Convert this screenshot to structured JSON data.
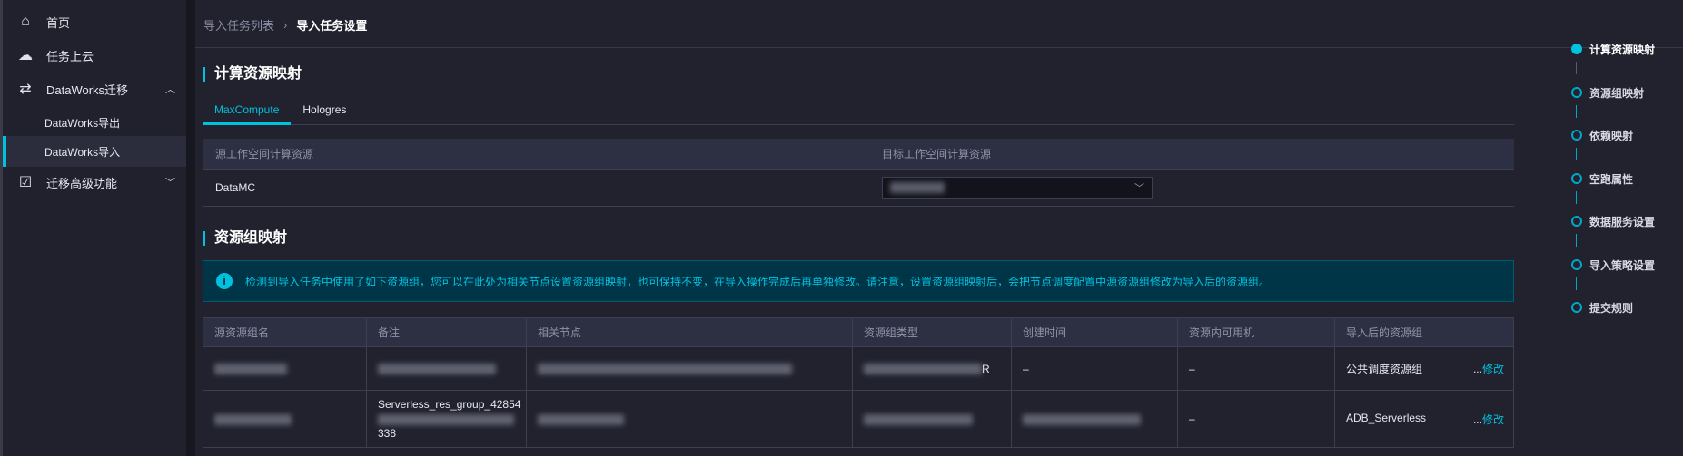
{
  "sidebar": {
    "items": [
      {
        "label": "首页",
        "icon": "home-icon"
      },
      {
        "label": "任务上云",
        "icon": "cloud-upload-icon"
      },
      {
        "label": "DataWorks迁移",
        "icon": "migrate-icon",
        "expanded": true,
        "children": [
          {
            "label": "DataWorks导出"
          },
          {
            "label": "DataWorks导入",
            "active": true
          }
        ]
      },
      {
        "label": "迁移高级功能",
        "icon": "calendar-check-icon",
        "expanded": false
      }
    ]
  },
  "breadcrumb": {
    "parent": "导入任务列表",
    "separator": "›",
    "current": "导入任务设置"
  },
  "compute": {
    "title": "计算资源映射",
    "tabs": [
      "MaxCompute",
      "Hologres"
    ],
    "active_tab": "MaxCompute",
    "columns": [
      "源工作空间计算资源",
      "目标工作空间计算资源"
    ],
    "rows": [
      {
        "source": "DataMC"
      }
    ]
  },
  "resource_group": {
    "title": "资源组映射",
    "alert": "检测到导入任务中使用了如下资源组，您可以在此处为相关节点设置资源组映射，也可保持不变，在导入操作完成后再单独修改。请注意，设置资源组映射后，会把节点调度配置中源资源组修改为导入后的资源组。",
    "columns": [
      "源资源组名",
      "备注",
      "相关节点",
      "资源组类型",
      "创建时间",
      "资源内可用机",
      "导入后的资源组"
    ],
    "rows": [
      {
        "created": "–",
        "machines": "–",
        "target": "公共调度资源组",
        "type_suffix": "R"
      },
      {
        "note_line1": "Serverless_res_group_42854",
        "note_line3": "338",
        "machines": "–",
        "target": "ADB_Serverless"
      }
    ],
    "edit_prefix": "...",
    "edit_label": "修改"
  },
  "steps": [
    {
      "label": "计算资源映射",
      "active": true
    },
    {
      "label": "资源组映射"
    },
    {
      "label": "依赖映射"
    },
    {
      "label": "空跑属性"
    },
    {
      "label": "数据服务设置"
    },
    {
      "label": "导入策略设置"
    },
    {
      "label": "提交规则"
    }
  ],
  "colors": {
    "accent": "#00c1de",
    "background": "#21222e",
    "alert_bg": "#003447"
  }
}
